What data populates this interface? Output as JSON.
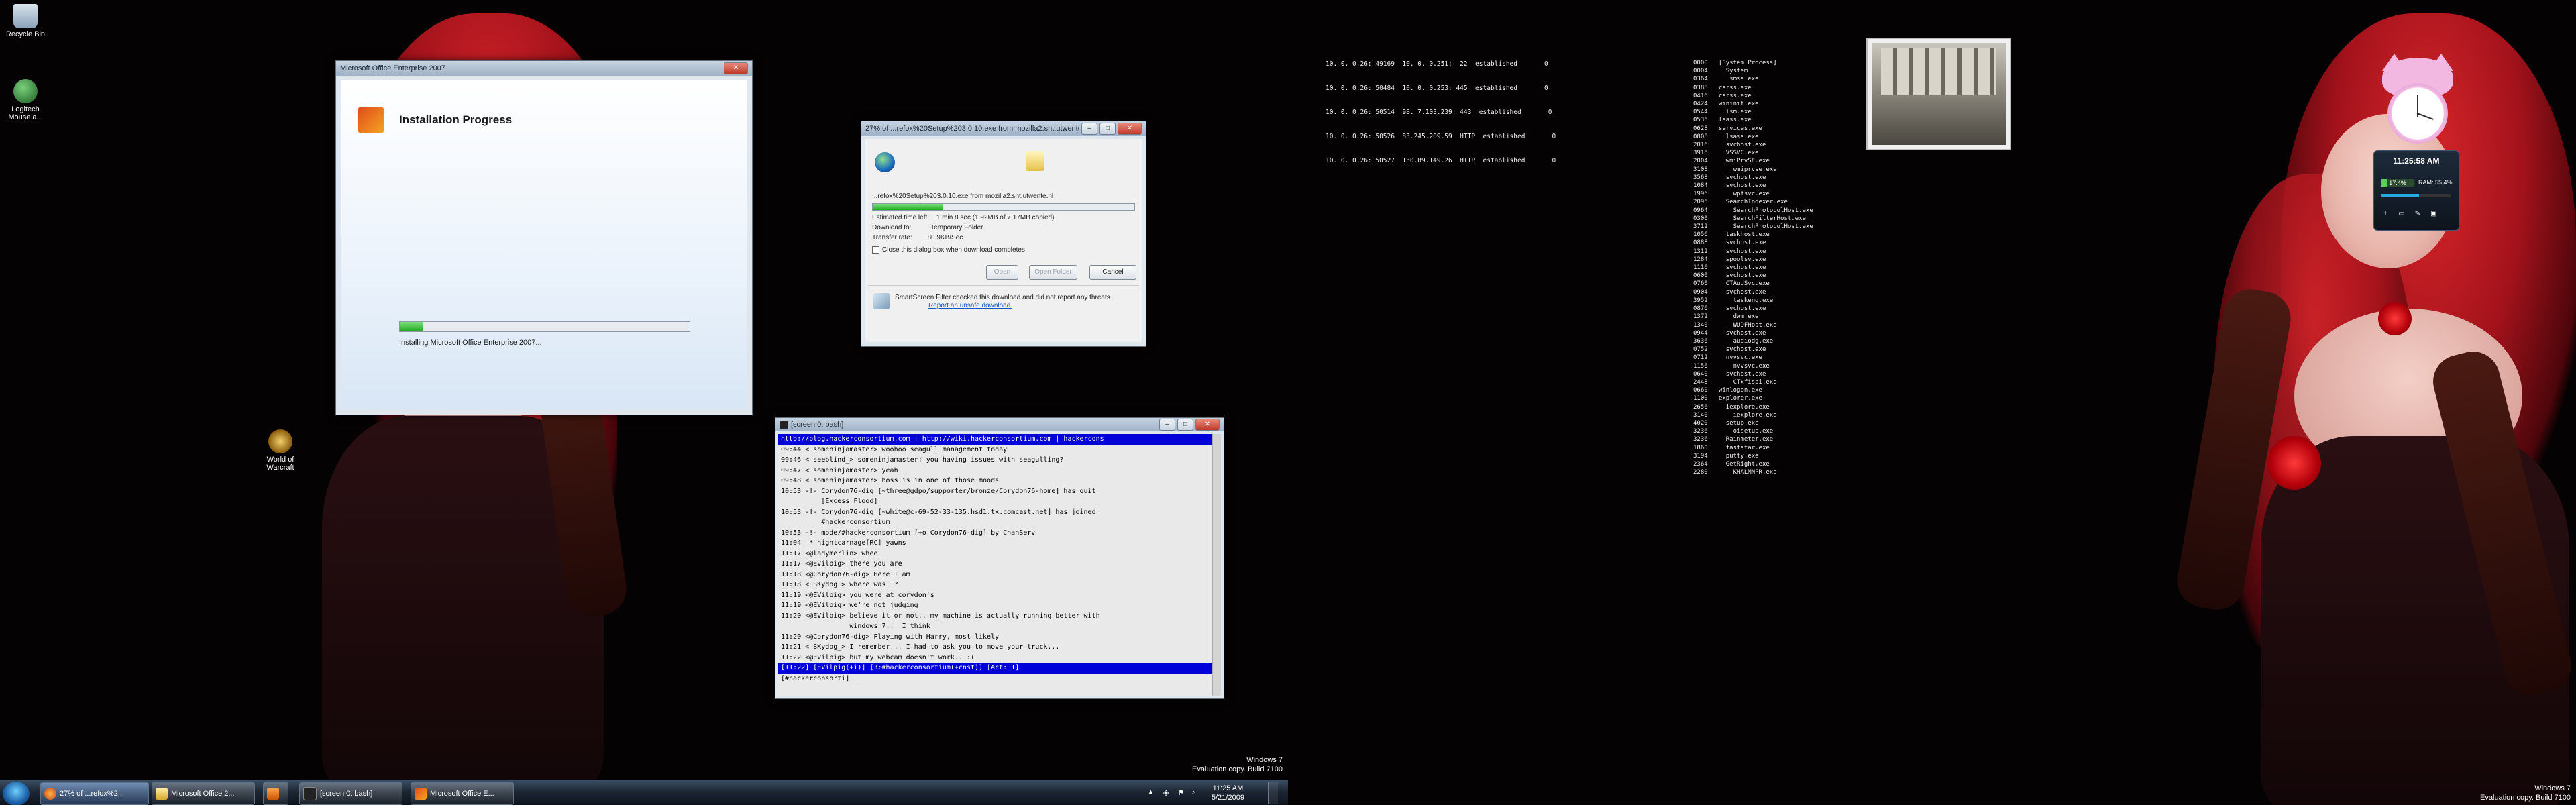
{
  "desktop_icons": [
    {
      "label": "Recycle Bin"
    },
    {
      "label": "Logitech Mouse a..."
    },
    {
      "label": "World of Warcraft"
    }
  ],
  "office_window": {
    "title": "Microsoft Office Enterprise 2007",
    "heading": "Installation Progress",
    "status": "Installing Microsoft Office Enterprise 2007...",
    "progress": 0.08
  },
  "download_dialog": {
    "title": "27% of ...refox%20Setup%203.0.10.exe from mozilla2.snt.utwente.nl",
    "source": "...refox%20Setup%203.0.10.exe from mozilla2.snt.utwente.nl",
    "progress": 0.27,
    "rows": [
      {
        "label": "Estimated time left:",
        "value": "1 min 8 sec (1.92MB of 7.17MB copied)"
      },
      {
        "label": "Download to:",
        "value": "Temporary Folder"
      },
      {
        "label": "Transfer rate:",
        "value": "80.9KB/Sec"
      }
    ],
    "checkbox": "Close this dialog box when download completes",
    "buttons": {
      "open": "Open",
      "open_folder": "Open Folder",
      "cancel": "Cancel"
    },
    "smartscreen": "SmartScreen Filter checked this download and did not report any threats.",
    "report_link": "Report an unsafe download."
  },
  "terminal": {
    "title": "[screen 0: bash]",
    "topic": "http://blog.hackerconsortium.com | http://wiki.hackerconsortium.com | hackercons",
    "lines": [
      "09:44 < someninjamaster> woohoo seagull management today",
      "09:46 < seeblind_> someninjamaster: you having issues with seagulling?",
      "09:47 < someninjamaster> yeah",
      "09:48 < someninjamaster> boss is in one of those moods",
      "10:53 -!- Corydon76-dig [~three@gdpo/supporter/bronze/Corydon76-home] has quit",
      "          [Excess Flood]",
      "10:53 -!- Corydon76-dig [~white@c-69-52-33-135.hsd1.tx.comcast.net] has joined",
      "          #hackerconsortium",
      "10:53 -!- mode/#hackerconsortium [+o Corydon76-dig] by ChanServ",
      "11:04  * nightcarnage[RC] yawns",
      "11:17 <@ladymerlin> whee",
      "11:17 <@EVilpig> there you are",
      "11:18 <@Corydon76-dig> Here I am",
      "11:18 < SKydog_> where was I?",
      "11:19 <@EVilpig> you were at corydon's",
      "11:19 <@EVilpig> we're not judging",
      "11:20 <@EVilpig> believe it or not.. my machine is actually running better with",
      "                 windows 7..  I think",
      "11:20 <@Corydon76-dig> Playing with Harry, most likely",
      "11:21 < SKydog_> I remember... I had to ask you to move your truck...",
      "11:22 <@EVilpig> but my webcam doesn't work.. :("
    ],
    "status": "[11:22] [EVilpig(+i)] [3:#hackerconsortium(+cnst)] [Act: 1]",
    "prompt": "[#hackerconsorti] _"
  },
  "taskbar": {
    "buttons": [
      "27% of ...refox%2...",
      "Microsoft Office 2...",
      "",
      "[screen 0: bash]",
      "Microsoft Office E..."
    ],
    "clock_time": "11:25 AM",
    "clock_date": "5/21/2009"
  },
  "watermark": {
    "line1": "Windows 7",
    "line2": "Evaluation copy. Build 7100"
  },
  "watermark2": {
    "line1": "Windows 7",
    "line2": "Evaluation copy. Build 7100"
  },
  "netstat": [
    "10. 0. 0.26: 49169  10. 0. 0.251:  22  established       0",
    "10. 0. 0.26: 50484  10. 0. 0.253: 445  established       0",
    "10. 0. 0.26: 50514  98. 7.103.239: 443  established       0",
    "10. 0. 0.26: 50526  83.245.209.59  HTTP  established       0",
    "10. 0. 0.26: 50527  130.89.149.26  HTTP  established       0"
  ],
  "processes": [
    "0000   [System Process]",
    "0004     System",
    "0364      smss.exe",
    "0388   csrss.exe",
    "0416   csrss.exe",
    "0424   wininit.exe",
    "0544     lsm.exe",
    "0536   lsass.exe",
    "0628   services.exe",
    "0808     lsass.exe",
    "2016     svchost.exe",
    "3916     VSSVC.exe",
    "2004     wmiPrvSE.exe",
    "3108       wmiprvse.exe",
    "3568     svchost.exe",
    "1084     svchost.exe",
    "1996       wpfsvc.exe",
    "2096     SearchIndexer.exe",
    "0964       SearchProtocolHost.exe",
    "0300       SearchFilterHost.exe",
    "3712       SearchProtocolHost.exe",
    "1056     taskhost.exe",
    "0888     svchost.exe",
    "1312     svchost.exe",
    "1284     spoolsv.exe",
    "1116     svchost.exe",
    "0600     svchost.exe",
    "0760     CTAudSvc.exe",
    "0904     svchost.exe",
    "3952       taskeng.exe",
    "0876     svchost.exe",
    "1372       dwm.exe",
    "1340       WUDFHost.exe",
    "0944     svchost.exe",
    "3636       audiodg.exe",
    "0752     svchost.exe",
    "0712     nvvsvc.exe",
    "1156       nvvsvc.exe",
    "0640     svchost.exe",
    "2448       CTxfispi.exe",
    "0660   winlogon.exe",
    "1100   explorer.exe",
    "2656     iexplore.exe",
    "3140       iexplore.exe",
    "4020     setup.exe",
    "3236       oisetup.exe",
    "3236     Rainmeter.exe",
    "1860     faststar.exe",
    "3194     putty.exe",
    "2364     GetRight.exe",
    "2280       KHALMNPR.exe"
  ],
  "clock_gadget": {
    "time": "11:25:58 AM",
    "cpu": "17.4%",
    "ram": "RAM: 55.4%"
  }
}
